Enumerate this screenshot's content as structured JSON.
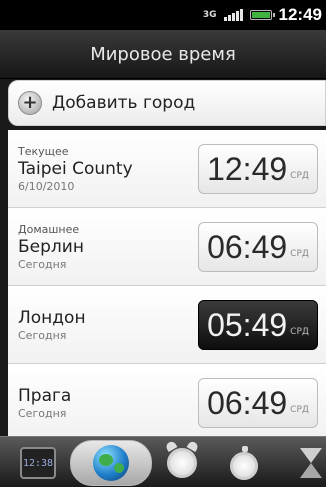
{
  "status_bar": {
    "network_type": "3G",
    "clock": "12:49",
    "icons": [
      "network-3g-icon",
      "signal-icon",
      "battery-icon"
    ],
    "battery_color": "#3fb23f"
  },
  "header": {
    "title": "Мировое время"
  },
  "add_city": {
    "label": "Добавить город",
    "icon": "plus-icon"
  },
  "cities": [
    {
      "note": "Текущее",
      "name": "Taipei County",
      "sub": "6/10/2010",
      "time": "12:49",
      "day": "СРД",
      "selected": false
    },
    {
      "note": "Домашнее",
      "name": "Берлин",
      "sub": "Сегодня",
      "time": "06:49",
      "day": "СРД",
      "selected": false
    },
    {
      "note": "",
      "name": "Лондон",
      "sub": "Сегодня",
      "time": "05:49",
      "day": "СРД",
      "selected": true
    },
    {
      "note": "",
      "name": "Прага",
      "sub": "Сегодня",
      "time": "06:49",
      "day": "СРД",
      "selected": false
    }
  ],
  "tab_bar": {
    "tabs": [
      {
        "icon": "desk-clock-icon",
        "display": "12:38",
        "active": false
      },
      {
        "icon": "globe-icon",
        "active": true
      },
      {
        "icon": "alarm-clock-icon",
        "active": false
      },
      {
        "icon": "stopwatch-icon",
        "active": false
      },
      {
        "icon": "hourglass-icon",
        "active": false
      }
    ]
  }
}
